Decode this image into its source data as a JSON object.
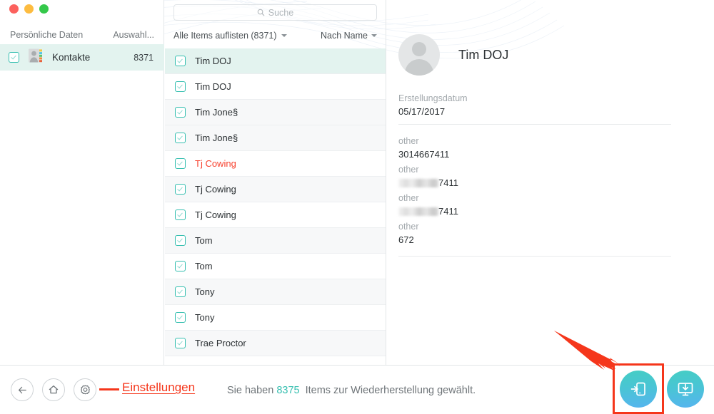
{
  "window": {
    "traffic_lights": [
      "close",
      "minimize",
      "zoom"
    ],
    "colors": {
      "close": "#fc615d",
      "minimize": "#fdbc40",
      "zoom": "#34c84a",
      "accent_teal": "#36bfb0",
      "annotation_red": "#f5361b",
      "deleted_text": "#f7412e",
      "selected_row": "#e3f3ef"
    }
  },
  "sidebar": {
    "header_left": "Persönliche Daten",
    "header_right": "Auswahl...",
    "items": [
      {
        "label": "Kontakte",
        "count": "8371",
        "checked": true,
        "selected": true,
        "icon": "contacts-icon"
      }
    ]
  },
  "list_panel": {
    "search": {
      "placeholder": "Suche",
      "value": "",
      "icon": "search-icon"
    },
    "filter_dropdown": {
      "label": "Alle Items auflisten (8371)",
      "icon": "chevron-down-icon"
    },
    "sort_dropdown": {
      "label": "Nach Name",
      "icon": "chevron-down-icon"
    },
    "rows": [
      {
        "name": "Tim DOJ",
        "checked": true,
        "selected": true,
        "deleted": false
      },
      {
        "name": "Tim DOJ",
        "checked": true,
        "selected": false,
        "deleted": false
      },
      {
        "name": "Tim Jone§",
        "checked": true,
        "selected": false,
        "deleted": false
      },
      {
        "name": "Tim Jone§",
        "checked": true,
        "selected": false,
        "deleted": false
      },
      {
        "name": "Tj Cowing",
        "checked": true,
        "selected": false,
        "deleted": true
      },
      {
        "name": "Tj Cowing",
        "checked": true,
        "selected": false,
        "deleted": false
      },
      {
        "name": "Tj Cowing",
        "checked": true,
        "selected": false,
        "deleted": false
      },
      {
        "name": "Tom",
        "checked": true,
        "selected": false,
        "deleted": false
      },
      {
        "name": "Tom",
        "checked": true,
        "selected": false,
        "deleted": false
      },
      {
        "name": "Tony",
        "checked": true,
        "selected": false,
        "deleted": false
      },
      {
        "name": "Tony",
        "checked": true,
        "selected": false,
        "deleted": false
      },
      {
        "name": "Trae Proctor",
        "checked": true,
        "selected": false,
        "deleted": false
      }
    ]
  },
  "detail": {
    "avatar_icon": "person-placeholder-icon",
    "name": "Tim DOJ",
    "created_label": "Erstellungsdatum",
    "created_value": "05/17/2017",
    "fields": [
      {
        "label": "other",
        "value": "3014667411",
        "redacted": false
      },
      {
        "label": "other",
        "value": "7411",
        "redacted": true
      },
      {
        "label": "other",
        "value": "7411",
        "redacted": true
      },
      {
        "label": "other",
        "value": "672",
        "redacted": false
      }
    ]
  },
  "bottom_bar": {
    "back_icon": "arrow-left-icon",
    "home_icon": "home-icon",
    "settings_icon": "gear-icon",
    "status": {
      "prefix": "Sie haben",
      "count": "8375",
      "suffix": "Items zur Wiederherstellung gewählt."
    },
    "actions": [
      {
        "name": "restore-to-device",
        "icon": "phone-restore-icon",
        "highlighted": true
      },
      {
        "name": "recover-to-computer",
        "icon": "computer-download-icon",
        "highlighted": false
      }
    ]
  },
  "annotations": {
    "settings_label": "Einstellungen",
    "arrow_icon": "red-arrow-icon",
    "highlight_box_icon": "red-highlight-box"
  }
}
